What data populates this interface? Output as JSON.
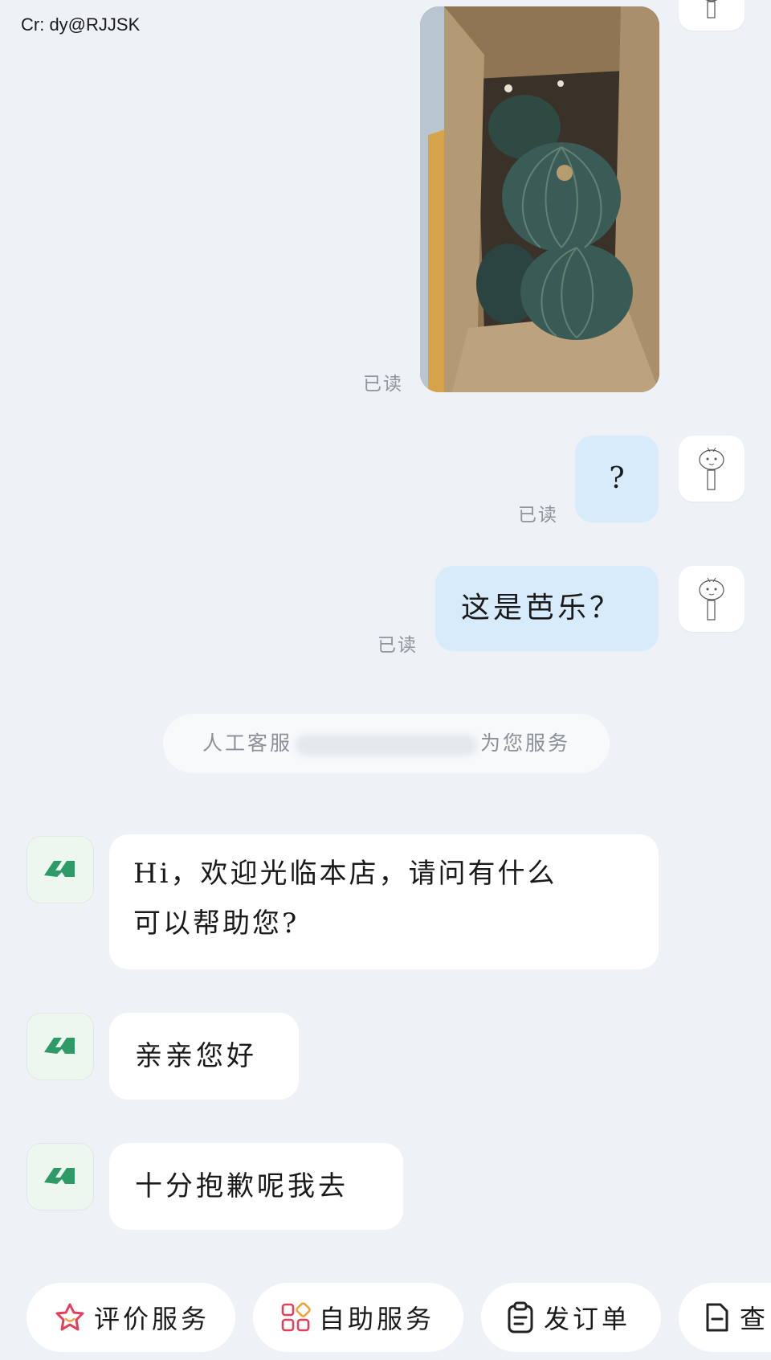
{
  "watermark": "Cr: dy@RJJSK",
  "messages": {
    "image": {
      "read": "已读"
    },
    "q1": {
      "text": "?",
      "read": "已读"
    },
    "q2": {
      "text": "这是芭乐？",
      "read": "已读"
    }
  },
  "system_notice": {
    "prefix": "人工客服",
    "suffix": "为您服务"
  },
  "replies": [
    {
      "line1": "Hi，欢迎光临本店，请问有什么",
      "line2": "可以帮助您?"
    },
    {
      "text": "亲亲您好"
    },
    {
      "text": "十分抱歉呢我去"
    }
  ],
  "quick_actions": [
    {
      "label": "评价服务",
      "icon": "star-flower-icon"
    },
    {
      "label": "自助服务",
      "icon": "grid-icon"
    },
    {
      "label": "发订单",
      "icon": "clipboard-icon"
    },
    {
      "label": "查",
      "icon": "document-icon"
    }
  ],
  "colors": {
    "background": "#eef2f6",
    "outgoing_bubble": "#d8ebfb",
    "incoming_bubble": "#ffffff",
    "shop_logo": "#2e9a68",
    "rate_icon": "#e2405a"
  }
}
